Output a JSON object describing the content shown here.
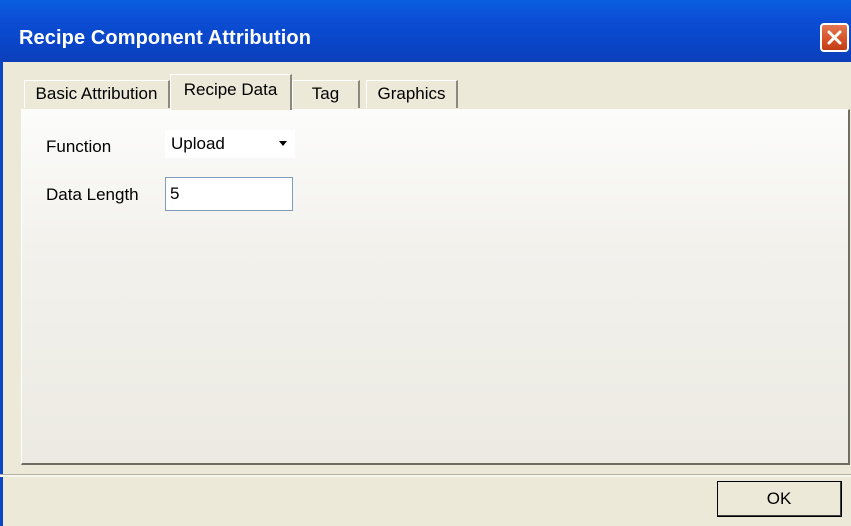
{
  "window": {
    "title": "Recipe Component Attribution"
  },
  "titlebar": {
    "close_icon": "close-icon"
  },
  "tabs": [
    {
      "label": "Basic Attribution",
      "active": false
    },
    {
      "label": "Recipe Data",
      "active": true
    },
    {
      "label": "Tag",
      "active": false
    },
    {
      "label": "Graphics",
      "active": false
    }
  ],
  "form": {
    "function_label": "Function",
    "function_value": "Upload",
    "data_length_label": "Data Length",
    "data_length_value": "5"
  },
  "footer": {
    "ok_label": "OK"
  },
  "colors": {
    "titlebar": "#0a4fd6",
    "close_button": "#d9572f",
    "window_background": "#ece9d8",
    "field_border": "#7f9db9"
  }
}
